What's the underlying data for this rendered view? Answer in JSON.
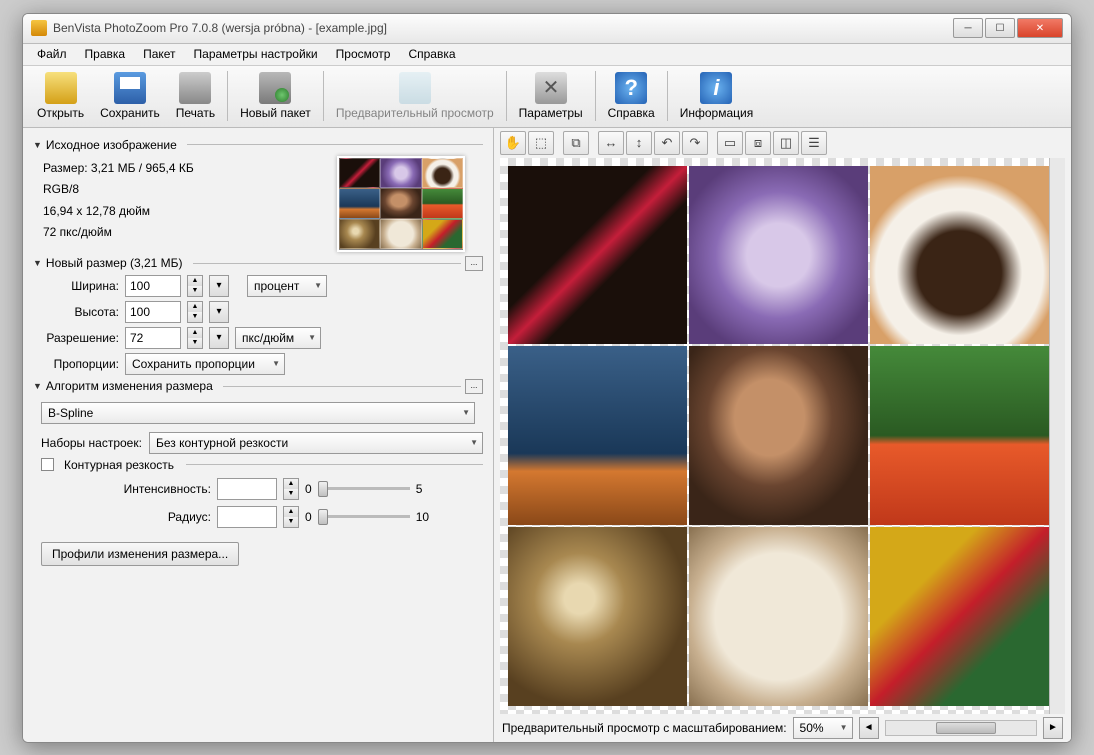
{
  "window": {
    "title": "BenVista PhotoZoom Pro 7.0.8 (wersja próbna) - [example.jpg]"
  },
  "menu": [
    "Файл",
    "Правка",
    "Пакет",
    "Параметры настройки",
    "Просмотр",
    "Справка"
  ],
  "toolbar": {
    "open": "Открыть",
    "save": "Сохранить",
    "print": "Печать",
    "batch": "Новый пакет",
    "preview": "Предварительный просмотр",
    "params": "Параметры",
    "help": "Справка",
    "info": "Информация"
  },
  "source": {
    "header": "Исходное изображение",
    "size": "Размер: 3,21 МБ / 965,4 КБ",
    "mode": "RGB/8",
    "dims": "16,94 x 12,78 дюйм",
    "res": "72 пкс/дюйм"
  },
  "newsize": {
    "header": "Новый размер (3,21 МБ)",
    "width_lbl": "Ширина:",
    "width_val": "100",
    "height_lbl": "Высота:",
    "height_val": "100",
    "unit": "процент",
    "res_lbl": "Разрешение:",
    "res_val": "72",
    "res_unit": "пкс/дюйм",
    "aspect_lbl": "Пропорции:",
    "aspect_val": "Сохранить пропорции"
  },
  "algo": {
    "header": "Алгоритм изменения размера",
    "method": "B-Spline",
    "presets_lbl": "Наборы настроек:",
    "presets_val": "Без контурной резкости",
    "unsharp": "Контурная резкость",
    "intensity_lbl": "Интенсивность:",
    "intensity_min": "0",
    "intensity_max": "5",
    "radius_lbl": "Радиус:",
    "radius_min": "0",
    "radius_max": "10",
    "profiles_btn": "Профили изменения размера..."
  },
  "preview": {
    "zoom_lbl": "Предварительный просмотр с масштабированием:",
    "zoom_val": "50%"
  }
}
